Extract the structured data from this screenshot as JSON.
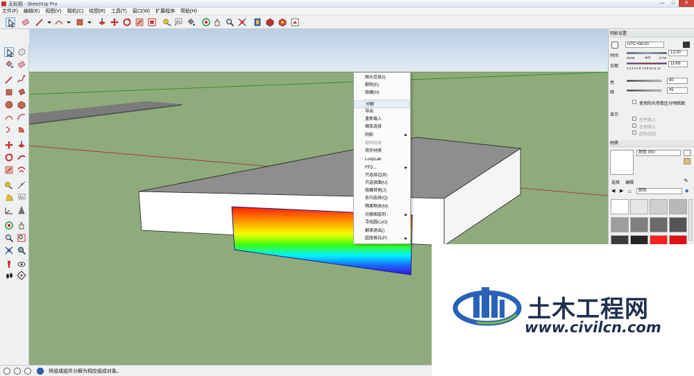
{
  "window": {
    "title": "无标题 - SketchUp Pro",
    "controls": [
      "—",
      "□",
      "✕"
    ]
  },
  "menubar": {
    "items": [
      "文件(F)",
      "编辑(E)",
      "视图(V)",
      "相机(C)",
      "绘图(R)",
      "工具(T)",
      "窗口(W)",
      "扩展程序",
      "帮助(H)"
    ]
  },
  "toolbar": {
    "icons": [
      "select-icon",
      "eraser-icon",
      "line-icon",
      "arc-icon",
      "rectangle-icon",
      "push-pull-icon",
      "move-icon",
      "rotate-icon",
      "scale-icon",
      "offset-icon",
      "tape-measure-icon",
      "text-icon",
      "paint-bucket-icon",
      "orbit-icon",
      "pan-icon",
      "zoom-icon",
      "zoom-extents-icon",
      "warehouse-icon",
      "extension-warehouse-icon",
      "layout-icon",
      "share-model-icon"
    ]
  },
  "context_menu": {
    "items": [
      {
        "label": "图元信息(I)",
        "type": "item"
      },
      {
        "label": "删除(E)",
        "type": "item"
      },
      {
        "label": "隐藏(H)",
        "type": "item"
      },
      {
        "label": "",
        "type": "sep"
      },
      {
        "label": "分解",
        "type": "highlight"
      },
      {
        "label": "导出",
        "type": "item"
      },
      {
        "label": "重新载入",
        "type": "item"
      },
      {
        "label": "缩放选择",
        "type": "item"
      },
      {
        "label": "阴影",
        "type": "submenu"
      },
      {
        "label": "解除粘接",
        "type": "disabled"
      },
      {
        "label": "用作材质",
        "type": "item"
      },
      {
        "label": "LoopLab",
        "type": "item"
      },
      {
        "label": "FFD...",
        "type": "submenu"
      },
      {
        "label": "只选择边(B)",
        "type": "item"
      },
      {
        "label": "只选择面(U)",
        "type": "item"
      },
      {
        "label": "隐藏其他(J)",
        "type": "item"
      },
      {
        "label": "反向选择(Q)",
        "type": "item"
      },
      {
        "label": "隔离物体(M)",
        "type": "item"
      },
      {
        "label": "切换图层到 :",
        "type": "submenu"
      },
      {
        "label": "寻找圆心(O)",
        "type": "item"
      },
      {
        "label": "翻滚退出()",
        "type": "item"
      },
      {
        "label": "超级推拉(P)",
        "type": "submenu"
      }
    ]
  },
  "shadow_panel": {
    "title": "阴影设置",
    "timezone": "UTC+08:00",
    "time_label": "时间",
    "time_ticks": [
      "06:58",
      "中午",
      "17:00"
    ],
    "time_value": "13:30",
    "date_label": "日期",
    "months": "1 2 3 4 5 6 7 8 9 10 11 12",
    "date_value": "11/08",
    "light_label": "亮",
    "light_value": "80",
    "dark_label": "暗",
    "dark_value": "45",
    "sun_option": "使用阳光参数区分明暗面",
    "display_label": "显示:",
    "display_options": [
      "在平面上",
      "在地面上",
      "起始边线"
    ]
  },
  "materials_panel": {
    "title": "材质",
    "material_name": "颜色 000",
    "tabs": [
      "选择",
      "编辑"
    ],
    "category": "颜色",
    "swatch_colors": [
      "#ffffff",
      "#e6e6e6",
      "#d0d0d0",
      "#b8b8b8",
      "#9e9e9e",
      "#808080",
      "#6a6a6a",
      "#555555",
      "#3c3c3c",
      "#262626",
      "#ff2020",
      "#e01010"
    ]
  },
  "statusbar": {
    "hint": "将组或组件分解为相应组成对象。"
  },
  "watermark": {
    "cn": "土木工程网",
    "url": "www.civilcn.com"
  },
  "colors": {
    "sky": "#d8e4ef",
    "ground": "#8fab7b",
    "box_top": "#8c8c8c",
    "box_side": "#ffffff",
    "box_dark": "#6f6f6f",
    "accent": "#2a62b8"
  }
}
